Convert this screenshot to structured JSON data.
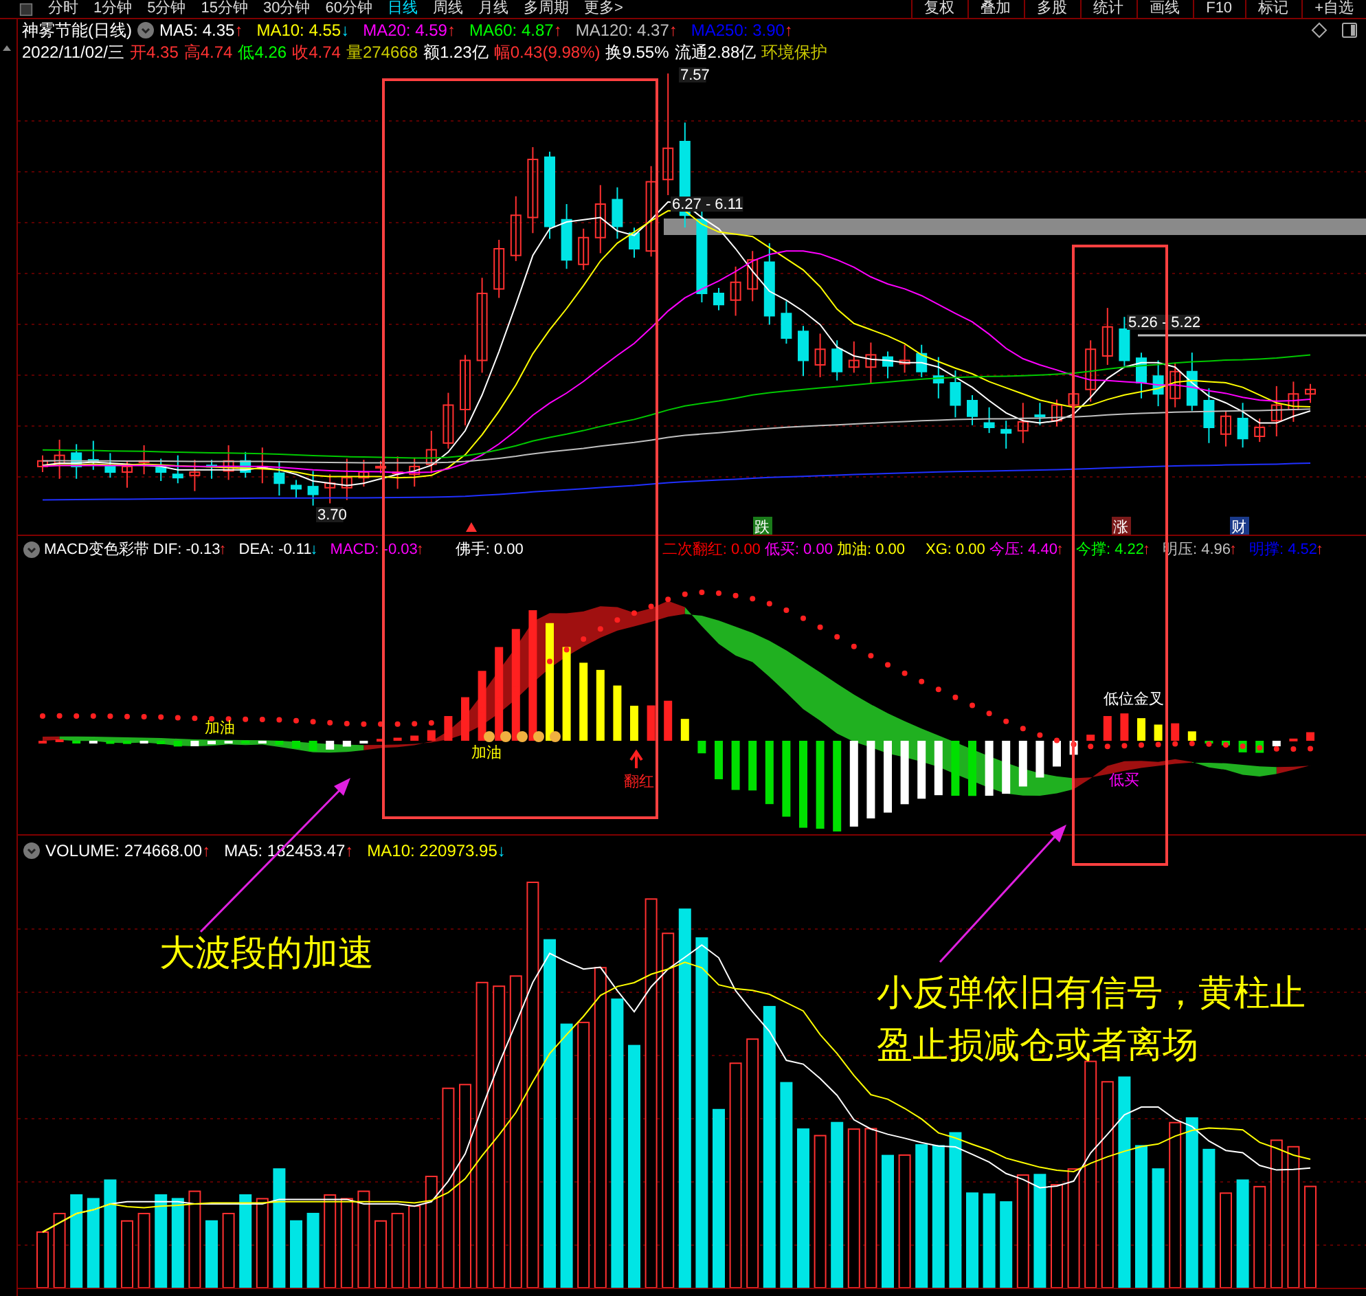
{
  "menu": {
    "periods": [
      {
        "label": "分时",
        "selected": false
      },
      {
        "label": "1分钟",
        "selected": false
      },
      {
        "label": "5分钟",
        "selected": false
      },
      {
        "label": "15分钟",
        "selected": false
      },
      {
        "label": "30分钟",
        "selected": false
      },
      {
        "label": "60分钟",
        "selected": false
      },
      {
        "label": "日线",
        "selected": true
      },
      {
        "label": "周线",
        "selected": false
      },
      {
        "label": "月线",
        "selected": false
      },
      {
        "label": "多周期",
        "selected": false
      },
      {
        "label": "更多>",
        "selected": false
      }
    ],
    "tools": [
      "复权",
      "叠加",
      "多股",
      "统计",
      "画线",
      "F10",
      "标记",
      "+自选"
    ]
  },
  "main_chart": {
    "title": "神雾节能(日线)",
    "indicators": [
      {
        "label": "MA5: 4.35",
        "color": "#ffffff",
        "arrow": "↑",
        "rising": true
      },
      {
        "label": "MA10: 4.55",
        "color": "#ffff00",
        "arrow": "↓",
        "rising": false
      },
      {
        "label": "MA20: 4.59",
        "color": "#ff00ff",
        "arrow": "↑",
        "rising": true
      },
      {
        "label": "MA60: 4.87",
        "color": "#00ff00",
        "arrow": "↑",
        "rising": true
      },
      {
        "label": "MA120: 4.37",
        "color": "#c0c0c0",
        "arrow": "↑",
        "rising": true
      },
      {
        "label": "MA250: 3.90",
        "color": "#0000ff",
        "arrow": "↑",
        "rising": true
      }
    ],
    "quote": [
      {
        "text": "2022/11/02/三",
        "color": "#ffffff"
      },
      {
        "text": "开4.35",
        "color": "#ff3232"
      },
      {
        "text": "高4.74",
        "color": "#ff3232"
      },
      {
        "text": "低4.26",
        "color": "#00ff00"
      },
      {
        "text": "收4.74",
        "color": "#ff3232"
      },
      {
        "text": "量274668",
        "color": "#cccc00"
      },
      {
        "text": "额1.23亿",
        "color": "#ffffff"
      },
      {
        "text": "幅0.43(9.98%)",
        "color": "#ff3232"
      },
      {
        "text": "换9.55%",
        "color": "#ffffff"
      },
      {
        "text": "流通2.88亿",
        "color": "#ffffff"
      },
      {
        "text": "环境保护",
        "color": "#cccc00"
      }
    ],
    "price_labels": [
      "7.57",
      "6.27 - 6.11",
      "3.70",
      "5.26 - 5.22"
    ],
    "event_tags": [
      {
        "label": "跌",
        "color": "#1a7a1a"
      },
      {
        "label": "涨",
        "color": "#7a1a1a"
      },
      {
        "label": "财",
        "color": "#1a3a8a"
      }
    ]
  },
  "macd_panel": {
    "title": "MACD变色彩带",
    "indicators": [
      {
        "label": "DIF: -0.13",
        "color": "#ffffff",
        "arrow": "↑",
        "rising": true
      },
      {
        "label": "DEA: -0.11",
        "color": "#ffffff",
        "arrow": "↓",
        "rising": false
      },
      {
        "label": "MACD: -0.03",
        "color": "#ff00ff",
        "arrow": "↑",
        "rising": true
      },
      {
        "label": "佛手: 0.00",
        "color": "#ffffff"
      },
      {
        "label": "二次翻红: 0.00",
        "color": "#ff0000"
      },
      {
        "label": "低买: 0.00",
        "color": "#ff00ff"
      },
      {
        "label": "加油: 0.00",
        "color": "#ffff00"
      },
      {
        "label": "XG: 0.00",
        "color": "#ffff00"
      },
      {
        "label": "今压: 4.40",
        "color": "#ff00ff",
        "arrow": "↑",
        "rising": true
      },
      {
        "label": "今撑: 4.22",
        "color": "#00ff00",
        "arrow": "↑",
        "rising": true
      },
      {
        "label": "明压: 4.96",
        "color": "#c0c0c0",
        "arrow": "↑",
        "rising": true
      },
      {
        "label": "明撑: 4.52",
        "color": "#0000ff",
        "arrow": "↑",
        "rising": true
      }
    ],
    "signals": [
      {
        "label": "加油",
        "color": "#ffff00"
      },
      {
        "label": "加油",
        "color": "#ffff00"
      },
      {
        "label": "翻红",
        "color": "#ff2020"
      },
      {
        "label": "低位金叉",
        "color": "#ffffff"
      },
      {
        "label": "低买",
        "color": "#ff00ff"
      }
    ]
  },
  "volume_panel": {
    "indicators": [
      {
        "label": "VOLUME: 274668.00",
        "color": "#ffffff",
        "arrow": "↑",
        "rising": true
      },
      {
        "label": "MA5: 182453.47",
        "color": "#ffffff",
        "arrow": "↑",
        "rising": true
      },
      {
        "label": "MA10: 220973.95",
        "color": "#ffff00",
        "arrow": "↓",
        "rising": false
      }
    ]
  },
  "annotations": [
    "大波段的加速",
    "小反弹依旧有信号，黄柱止盈止损减仓或者离场"
  ]
}
